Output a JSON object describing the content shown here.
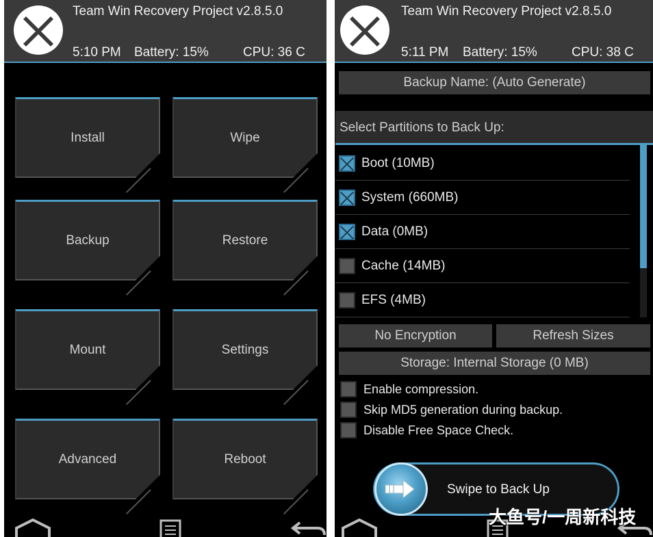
{
  "left": {
    "header": {
      "title": "Team Win Recovery Project  v2.8.5.0",
      "time": "5:10 PM",
      "battery": "Battery: 15%",
      "cpu": "CPU: 36 C"
    },
    "buttons": [
      "Install",
      "Wipe",
      "Backup",
      "Restore",
      "Mount",
      "Settings",
      "Advanced",
      "Reboot"
    ]
  },
  "right": {
    "header": {
      "title": "Team Win Recovery Project  v2.8.5.0",
      "time": "5:11 PM",
      "battery": "Battery: 15%",
      "cpu": "CPU: 38 C"
    },
    "backup_name": "Backup Name: (Auto Generate)",
    "section_title": "Select Partitions to Back Up:",
    "partitions": [
      {
        "label": "Boot (10MB)",
        "checked": true
      },
      {
        "label": "System (660MB)",
        "checked": true
      },
      {
        "label": "Data (0MB)",
        "checked": true
      },
      {
        "label": "Cache (14MB)",
        "checked": false
      },
      {
        "label": "EFS (4MB)",
        "checked": false
      }
    ],
    "no_encryption": "No Encryption",
    "refresh_sizes": "Refresh Sizes",
    "storage": "Storage: Internal Storage (0 MB)",
    "options": [
      {
        "label": "Enable compression.",
        "checked": false
      },
      {
        "label": "Skip MD5 generation during backup.",
        "checked": false
      },
      {
        "label": "Disable Free Space Check.",
        "checked": false
      }
    ],
    "swipe_label": "Swipe to Back Up"
  },
  "nav": {
    "home_icon": "home-icon",
    "log_icon": "log-icon",
    "back_icon": "back-icon"
  },
  "watermark": "大鱼号/一周新科技",
  "colors": {
    "accent": "#4d9ec7",
    "header_bg": "#3a3a3a",
    "button_bg": "#2b2b2b"
  }
}
